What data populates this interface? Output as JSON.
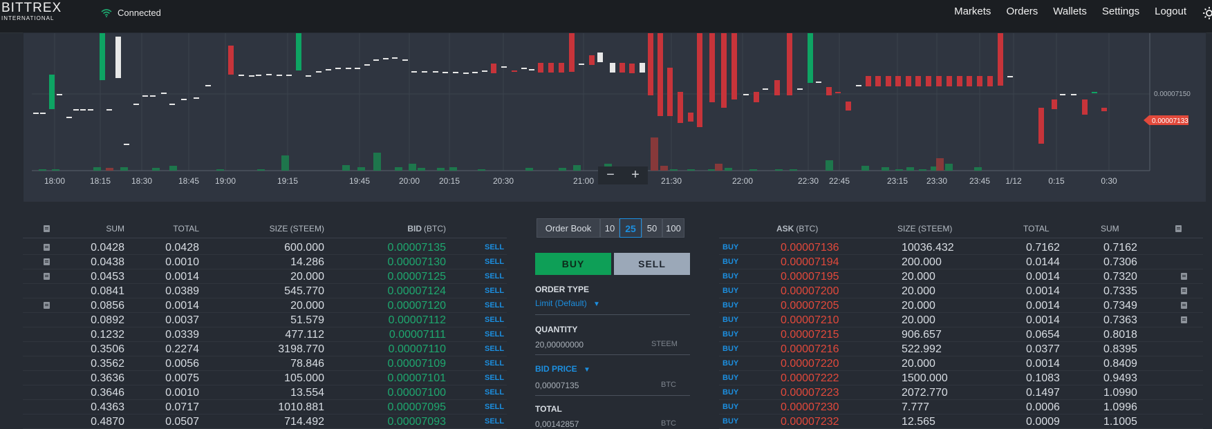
{
  "app": {
    "logo_main": "BITTREX",
    "logo_sub": "INTERNATIONAL",
    "status": "Connected"
  },
  "nav": [
    "Markets",
    "Orders",
    "Wallets",
    "Settings",
    "Logout"
  ],
  "chart": {
    "time_labels": [
      "18:00",
      "18:15",
      "18:30",
      "18:45",
      "19:00",
      "19:15",
      "19:45",
      "20:00",
      "20:15",
      "20:30",
      "21:00",
      "21:30",
      "22:00",
      "22:30",
      "22:45",
      "23:15",
      "23:30",
      "23:45",
      "1/12",
      "0:15",
      "0:30"
    ],
    "price_label": "0.00007150",
    "last_price": "0.00007133",
    "zoom_out": "−",
    "zoom_in": "+"
  },
  "bids": {
    "headers": {
      "sum": "SUM",
      "total": "TOTAL",
      "size": "SIZE (STEEM)",
      "bid": "BID",
      "bid_unit": "(BTC)"
    },
    "rows": [
      {
        "sum": "0.0428",
        "total": "0.0428",
        "size": "600.000",
        "price": "0.00007135",
        "action": "SELL",
        "doc": true
      },
      {
        "sum": "0.0438",
        "total": "0.0010",
        "size": "14.286",
        "price": "0.00007130",
        "action": "SELL",
        "doc": true
      },
      {
        "sum": "0.0453",
        "total": "0.0014",
        "size": "20.000",
        "price": "0.00007125",
        "action": "SELL",
        "doc": true
      },
      {
        "sum": "0.0841",
        "total": "0.0389",
        "size": "545.770",
        "price": "0.00007124",
        "action": "SELL",
        "doc": false
      },
      {
        "sum": "0.0856",
        "total": "0.0014",
        "size": "20.000",
        "price": "0.00007120",
        "action": "SELL",
        "doc": true
      },
      {
        "sum": "0.0892",
        "total": "0.0037",
        "size": "51.579",
        "price": "0.00007112",
        "action": "SELL",
        "doc": false
      },
      {
        "sum": "0.1232",
        "total": "0.0339",
        "size": "477.112",
        "price": "0.00007111",
        "action": "SELL",
        "doc": false
      },
      {
        "sum": "0.3506",
        "total": "0.2274",
        "size": "3198.770",
        "price": "0.00007110",
        "action": "SELL",
        "doc": false
      },
      {
        "sum": "0.3562",
        "total": "0.0056",
        "size": "78.846",
        "price": "0.00007109",
        "action": "SELL",
        "doc": false
      },
      {
        "sum": "0.3636",
        "total": "0.0075",
        "size": "105.000",
        "price": "0.00007101",
        "action": "SELL",
        "doc": false
      },
      {
        "sum": "0.3646",
        "total": "0.0010",
        "size": "13.554",
        "price": "0.00007100",
        "action": "SELL",
        "doc": false
      },
      {
        "sum": "0.4363",
        "total": "0.0717",
        "size": "1010.881",
        "price": "0.00007095",
        "action": "SELL",
        "doc": false
      },
      {
        "sum": "0.4870",
        "total": "0.0507",
        "size": "714.492",
        "price": "0.00007093",
        "action": "SELL",
        "doc": false
      }
    ]
  },
  "asks": {
    "headers": {
      "ask": "ASK",
      "ask_unit": "(BTC)",
      "size": "SIZE (STEEM)",
      "total": "TOTAL",
      "sum": "SUM"
    },
    "rows": [
      {
        "action": "BUY",
        "price": "0.00007136",
        "size": "10036.432",
        "total": "0.7162",
        "sum": "0.7162",
        "doc": false
      },
      {
        "action": "BUY",
        "price": "0.00007194",
        "size": "200.000",
        "total": "0.0144",
        "sum": "0.7306",
        "doc": false
      },
      {
        "action": "BUY",
        "price": "0.00007195",
        "size": "20.000",
        "total": "0.0014",
        "sum": "0.7320",
        "doc": true
      },
      {
        "action": "BUY",
        "price": "0.00007200",
        "size": "20.000",
        "total": "0.0014",
        "sum": "0.7335",
        "doc": true
      },
      {
        "action": "BUY",
        "price": "0.00007205",
        "size": "20.000",
        "total": "0.0014",
        "sum": "0.7349",
        "doc": true
      },
      {
        "action": "BUY",
        "price": "0.00007210",
        "size": "20.000",
        "total": "0.0014",
        "sum": "0.7363",
        "doc": true
      },
      {
        "action": "BUY",
        "price": "0.00007215",
        "size": "906.657",
        "total": "0.0654",
        "sum": "0.8018",
        "doc": false
      },
      {
        "action": "BUY",
        "price": "0.00007216",
        "size": "522.992",
        "total": "0.0377",
        "sum": "0.8395",
        "doc": false
      },
      {
        "action": "BUY",
        "price": "0.00007220",
        "size": "20.000",
        "total": "0.0014",
        "sum": "0.8409",
        "doc": false
      },
      {
        "action": "BUY",
        "price": "0.00007222",
        "size": "1500.000",
        "total": "0.1083",
        "sum": "0.9493",
        "doc": false
      },
      {
        "action": "BUY",
        "price": "0.00007223",
        "size": "2072.770",
        "total": "0.1497",
        "sum": "1.0990",
        "doc": false
      },
      {
        "action": "BUY",
        "price": "0.00007230",
        "size": "7.777",
        "total": "0.0006",
        "sum": "1.0996",
        "doc": false
      },
      {
        "action": "BUY",
        "price": "0.00007232",
        "size": "12.565",
        "total": "0.0009",
        "sum": "1.1005",
        "doc": false
      }
    ]
  },
  "order_form": {
    "tab_label": "Order Book",
    "depth_options": [
      "10",
      "25",
      "50",
      "100"
    ],
    "depth_selected": "25",
    "buy_label": "BUY",
    "sell_label": "SELL",
    "order_type_label": "ORDER TYPE",
    "order_type_value": "Limit (Default)",
    "quantity_label": "QUANTITY",
    "quantity_value": "20,00000000",
    "quantity_unit": "STEEM",
    "bid_price_label": "BID PRICE",
    "bid_price_value": "0,00007135",
    "bid_price_unit": "BTC",
    "total_label": "TOTAL",
    "total_value": "0,00142857",
    "total_unit": "BTC"
  },
  "colors": {
    "green": "#1ea86f",
    "red": "#e2493b",
    "blue": "#1c8fe0"
  }
}
